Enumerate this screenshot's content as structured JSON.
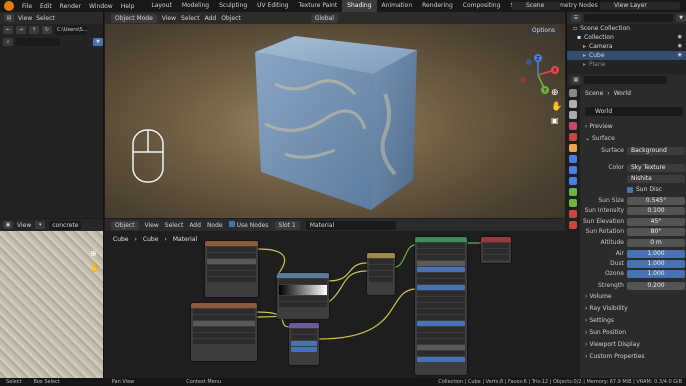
{
  "topbar": {
    "menus": [
      "File",
      "Edit",
      "Render",
      "Window",
      "Help"
    ],
    "workspaces": [
      "Layout",
      "Modeling",
      "Sculpting",
      "UV Editing",
      "Texture Paint",
      "Shading",
      "Animation",
      "Rendering",
      "Compositing",
      "Scripting",
      "Geometry Nodes"
    ],
    "active_workspace": "Shading",
    "scene": "Scene",
    "view_layer": "View Layer"
  },
  "file_browser": {
    "menus": [
      "View",
      "Select"
    ],
    "path": "C:\\Users\\S..."
  },
  "viewport": {
    "mode": "Object Mode",
    "menus": [
      "View",
      "Select",
      "Add",
      "Object"
    ],
    "orientation": "Global",
    "options_label": "Options",
    "gizmo_axes": [
      "X",
      "Y",
      "Z"
    ]
  },
  "outliner": {
    "root": "Scene Collection",
    "items": [
      {
        "label": "Collection"
      },
      {
        "label": "Camera"
      },
      {
        "label": "Cube"
      },
      {
        "label": "Plane"
      }
    ]
  },
  "properties": {
    "breadcrumb_scene": "Scene",
    "breadcrumb_world": "World",
    "world_name": "World",
    "panels_top": [
      "Preview",
      "Surface"
    ],
    "surface_label": "Surface",
    "surface_value": "Background",
    "color_label": "Color",
    "color_value": "Sky Texture",
    "sky_type": "Nishita",
    "sun_disc": "Sun Disc",
    "fields": [
      {
        "label": "Sun Size",
        "value": "0.545°"
      },
      {
        "label": "Sun Intensity",
        "value": "0.100"
      },
      {
        "label": "Sun Elevation",
        "value": "45°"
      },
      {
        "label": "Sun Rotation",
        "value": "80°"
      },
      {
        "label": "Altitude",
        "value": "0 m"
      },
      {
        "label": "Air",
        "value": "1.000"
      },
      {
        "label": "Dust",
        "value": "1.000"
      },
      {
        "label": "Ozone",
        "value": "1.000"
      },
      {
        "label": "Strength",
        "value": "0.200"
      }
    ],
    "panels_bottom": [
      "Volume",
      "Ray Visibility",
      "Settings",
      "Sun Position",
      "Viewport Display",
      "Custom Properties"
    ]
  },
  "image_editor": {
    "menu": "View",
    "image_name": "concrete"
  },
  "node_editor": {
    "type": "Object",
    "menus": [
      "View",
      "Select",
      "Add",
      "Node"
    ],
    "use_nodes": "Use Nodes",
    "slot": "Slot 1",
    "material": "Material",
    "breadcrumb": [
      "Cube",
      "Cube",
      "Material"
    ]
  },
  "statusbar": {
    "items": [
      "Select",
      "Box Select",
      "Pan View",
      "Context Menu"
    ],
    "stats": "Collection | Cube | Verts:8 | Faces:6 | Tris:12 | Objects:0/2 | Memory: 67.9 MiB | VRAM: 0.3/4.0 GiB"
  },
  "colors": {
    "accent": "#4772b3",
    "header": "#2b2b2b",
    "panel": "#232323"
  }
}
